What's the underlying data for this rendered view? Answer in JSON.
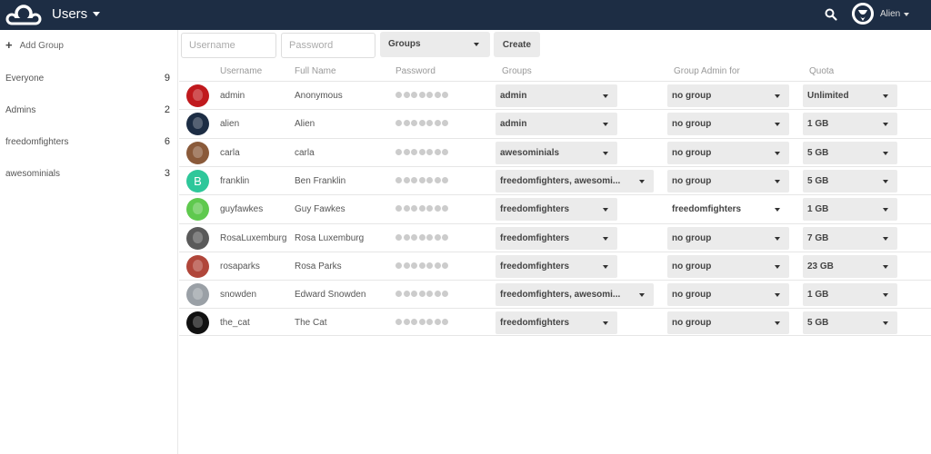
{
  "header": {
    "app_title": "Users",
    "user_name": "Alien"
  },
  "sidebar": {
    "add_group_label": "Add Group",
    "groups": [
      {
        "name": "Everyone",
        "count": "9"
      },
      {
        "name": "Admins",
        "count": "2"
      },
      {
        "name": "freedomfighters",
        "count": "6"
      },
      {
        "name": "awesominials",
        "count": "3"
      }
    ]
  },
  "controls": {
    "username_placeholder": "Username",
    "password_placeholder": "Password",
    "groups_select_label": "Groups",
    "create_label": "Create"
  },
  "table": {
    "headers": {
      "username": "Username",
      "full_name": "Full Name",
      "password": "Password",
      "groups": "Groups",
      "group_admin": "Group Admin for",
      "quota": "Quota"
    },
    "rows": [
      {
        "username": "admin",
        "full_name": "Anonymous",
        "groups": "admin",
        "group_admin": "no group",
        "quota": "Unlimited",
        "avatar_color": "#c0191d"
      },
      {
        "username": "alien",
        "full_name": "Alien",
        "groups": "admin",
        "group_admin": "no group",
        "quota": "1 GB",
        "avatar_color": "#1d2d44"
      },
      {
        "username": "carla",
        "full_name": "carla",
        "groups": "awesominials",
        "group_admin": "no group",
        "quota": "5 GB",
        "avatar_color": "#8a5a3a"
      },
      {
        "username": "franklin",
        "full_name": "Ben Franklin",
        "groups": "freedomfighters, awesomi...",
        "group_admin": "no group",
        "quota": "5 GB",
        "avatar_color": "#2ec79a",
        "avatar_letter": "B"
      },
      {
        "username": "guyfawkes",
        "full_name": "Guy Fawkes",
        "groups": "freedomfighters",
        "group_admin": "freedomfighters",
        "quota": "1 GB",
        "avatar_color": "#5fc94e"
      },
      {
        "username": "RosaLuxemburg",
        "full_name": "Rosa Luxemburg",
        "groups": "freedomfighters",
        "group_admin": "no group",
        "quota": "7 GB",
        "avatar_color": "#5a5a5a"
      },
      {
        "username": "rosaparks",
        "full_name": "Rosa Parks",
        "groups": "freedomfighters",
        "group_admin": "no group",
        "quota": "23 GB",
        "avatar_color": "#b0463a"
      },
      {
        "username": "snowden",
        "full_name": "Edward Snowden",
        "groups": "freedomfighters, awesomi...",
        "group_admin": "no group",
        "quota": "1 GB",
        "avatar_color": "#9aa0a6"
      },
      {
        "username": "the_cat",
        "full_name": "The Cat",
        "groups": "freedomfighters",
        "group_admin": "no group",
        "quota": "5 GB",
        "avatar_color": "#111111"
      }
    ]
  },
  "colors": {
    "header_bg": "#1d2d44",
    "select_bg": "#ebebeb"
  }
}
